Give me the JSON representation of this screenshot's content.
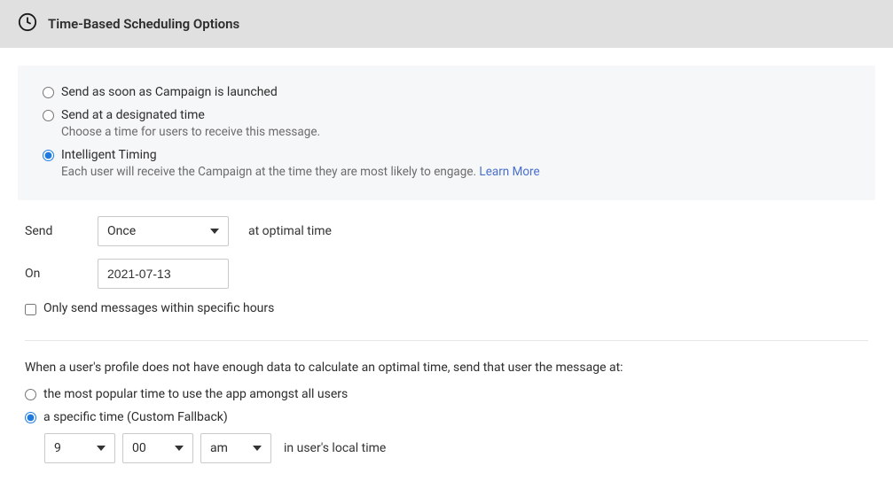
{
  "header": {
    "title": "Time-Based Scheduling Options"
  },
  "schedule_type": {
    "option1": {
      "label": "Send as soon as Campaign is launched"
    },
    "option2": {
      "label": "Send at a designated time",
      "sub": "Choose a time for users to receive this message."
    },
    "option3": {
      "label": "Intelligent Timing",
      "sub": "Each user will receive the Campaign at the time they are most likely to engage. ",
      "link": "Learn More"
    }
  },
  "send_config": {
    "send_label": "Send",
    "frequency": "Once",
    "suffix": "at optimal time",
    "on_label": "On",
    "date": "2021-07-13",
    "hours_checkbox": "Only send messages within specific hours"
  },
  "fallback": {
    "prompt": "When a user's profile does not have enough data to calculate an optimal time, send that user the message at:",
    "opt_popular": "the most popular time to use the app amongst all users",
    "opt_custom": "a specific time (Custom Fallback)",
    "hour": "9",
    "minute": "00",
    "ampm": "am",
    "tz_label": "in user's local time"
  }
}
